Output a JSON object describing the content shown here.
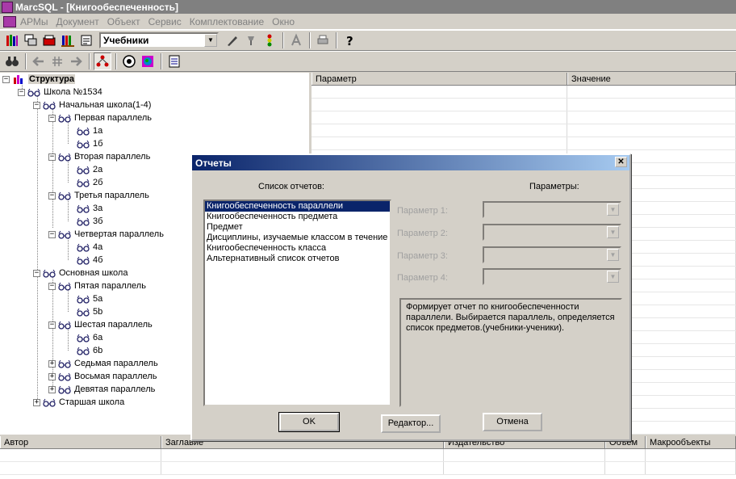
{
  "window": {
    "title": "MarcSQL - [Книгообеспеченность]"
  },
  "menu": {
    "items": [
      "АРМы",
      "Документ",
      "Объект",
      "Сервис",
      "Комплектование",
      "Окно"
    ]
  },
  "toolbar": {
    "combo_value": "Учебники",
    "icons": [
      "books-icon",
      "windows-icon",
      "card-stack-icon",
      "shelf-icon",
      "reader-icon",
      "pen-icon",
      "lamp-icon",
      "traffic-light-icon",
      "font-icon",
      "print-icon",
      "help-icon"
    ]
  },
  "toolbar2": {
    "icons": [
      "binoculars-icon",
      "back-arrow-icon",
      "grid-icon",
      "forward-arrow-icon",
      "tree-icon",
      "eye-icon",
      "globe-icon",
      "doc-icon"
    ]
  },
  "tree": {
    "root": "Структура",
    "school": "Школа №1534",
    "nodes": {
      "primary": "Начальная школа(1-4)",
      "p1": "Первая параллель",
      "c1a": "1а",
      "c1b": "1б",
      "p2": "Вторая параллель",
      "c2a": "2а",
      "c2b": "2б",
      "p3": "Третья параллель",
      "c3a": "3а",
      "c3b": "3б",
      "p4": "Четвертая параллель",
      "c4a": "4а",
      "c4b": "4б",
      "basic": "Основная школа",
      "p5": "Пятая параллель",
      "c5a": "5а",
      "c5b": "5b",
      "p6": "Шестая параллель",
      "c6a": "6а",
      "c6b": "6b",
      "p7": "Седьмая параллель",
      "p8": "Восьмая параллель",
      "p9": "Девятая параллель",
      "senior": "Старшая школа"
    }
  },
  "propgrid": {
    "col_param": "Параметр",
    "col_value": "Значение"
  },
  "bottomgrid": {
    "cols": [
      "Автор",
      "Заглавие",
      "Издательство",
      "Объем",
      "Макрообъекты"
    ]
  },
  "dialog": {
    "title": "Отчеты",
    "list_label": "Список отчетов:",
    "params_label": "Параметры:",
    "reports": [
      "Книгообеспеченность параллели",
      "Книгообеспеченность предмета",
      "Предмет",
      "Дисциплины, изучаемые классом в течение",
      "Книгообеспеченность класса",
      "Альтернативный список отчетов"
    ],
    "param_labels": [
      "Параметр 1:",
      "Параметр 2:",
      "Параметр 3:",
      "Параметр 4:"
    ],
    "description": "Формирует отчет по книгообеспеченности параллели. Выбирается параллель, определяется список предметов.(учебники-ученики).",
    "ok": "OK",
    "editor": "Редактор...",
    "cancel": "Отмена"
  }
}
